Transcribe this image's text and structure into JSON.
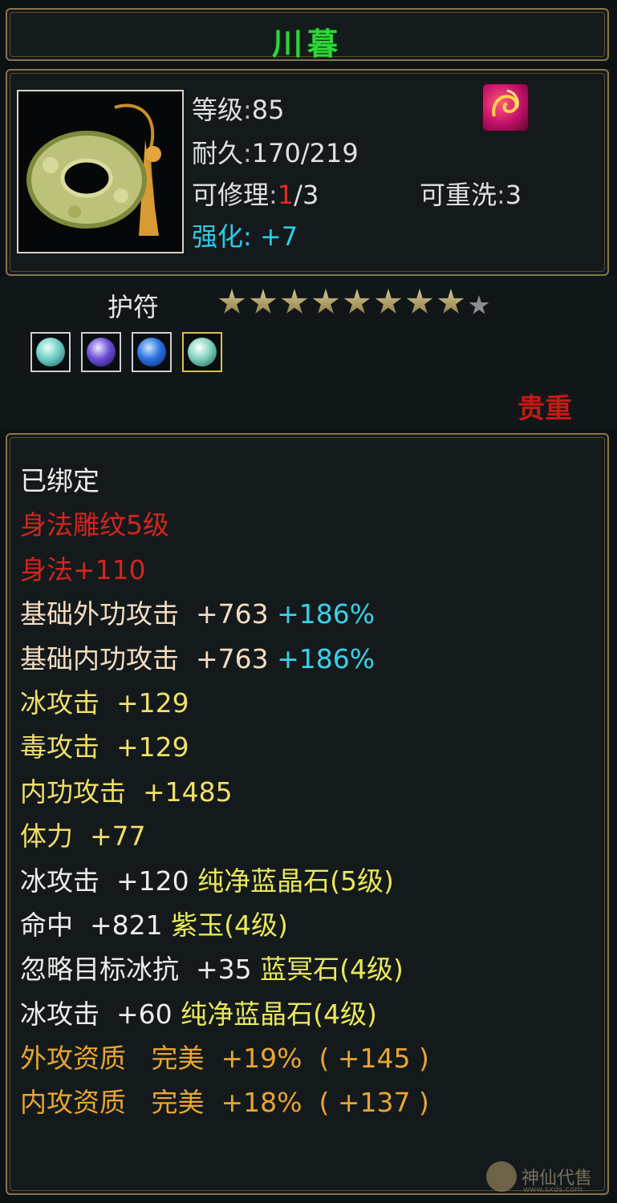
{
  "item": {
    "name": "川暮",
    "rarity": "贵重",
    "type": "护符",
    "level_label": "等级",
    "level_value": "85",
    "durability_label": "耐久",
    "durability_value": "170/219",
    "repair_label": "可修理",
    "repair_used": "1",
    "repair_total": "/3",
    "rewash_label": "可重洗",
    "rewash_value": "3",
    "enhance_label": "强化",
    "enhance_value": "+7",
    "separator": ":",
    "item_icon": "jade-ring-amulet-icon",
    "skill_icon": "agility-swirl-icon"
  },
  "stars": {
    "filled": 8,
    "total": 9
  },
  "gems": [
    {
      "name": "cyan-jade-gem-icon",
      "color": "#6fd0c6"
    },
    {
      "name": "purple-jade-gem-icon",
      "color": "#6b4ed6"
    },
    {
      "name": "blue-crystal-gem-icon",
      "color": "#2a72e0"
    },
    {
      "name": "teal-jade-gem-icon",
      "color": "#7fd2c0"
    }
  ],
  "stats": [
    {
      "label": "已绑定",
      "value": "",
      "bonus": "",
      "class": "c-white"
    },
    {
      "label": "身法雕纹5级",
      "value": "",
      "bonus": "",
      "class": "c-red"
    },
    {
      "label": "身法+110",
      "value": "",
      "bonus": "",
      "class": "c-red"
    },
    {
      "label": "基础外功攻击",
      "value": "+763",
      "bonus": "+186%",
      "class": "c-peach"
    },
    {
      "label": "基础内功攻击",
      "value": "+763",
      "bonus": "+186%",
      "class": "c-peach"
    },
    {
      "label": "冰攻击",
      "value": "+129",
      "bonus": "",
      "class": "c-yellow"
    },
    {
      "label": "毒攻击",
      "value": "+129",
      "bonus": "",
      "class": "c-yellow"
    },
    {
      "label": "内功攻击",
      "value": "+1485",
      "bonus": "",
      "class": "c-yellow"
    },
    {
      "label": "体力",
      "value": "+77",
      "bonus": "",
      "class": "c-yellow"
    },
    {
      "label": "冰攻击",
      "value": "+120",
      "gem": "纯净蓝晶石",
      "gem_level": "(5级)",
      "class": "c-white"
    },
    {
      "label": "命中",
      "value": "+821",
      "gem": "紫玉",
      "gem_level": "(4级)",
      "class": "c-white"
    },
    {
      "label": "忽略目标冰抗",
      "value": "+35",
      "gem": "蓝冥石",
      "gem_level": "(4级)",
      "class": "c-white"
    },
    {
      "label": "冰攻击",
      "value": "+60",
      "gem": "纯净蓝晶石",
      "gem_level": "(4级)",
      "class": "c-white"
    },
    {
      "label": "外攻资质",
      "value": "完美",
      "bonus": "+19%",
      "extra": "( +145 )",
      "class": "c-orange"
    },
    {
      "label": "内攻资质",
      "value": "完美",
      "bonus": "+18%",
      "extra": "( +137 )",
      "class": "c-orange"
    }
  ],
  "watermark": {
    "text": "神仙代售",
    "url": "www.sxds.com"
  }
}
